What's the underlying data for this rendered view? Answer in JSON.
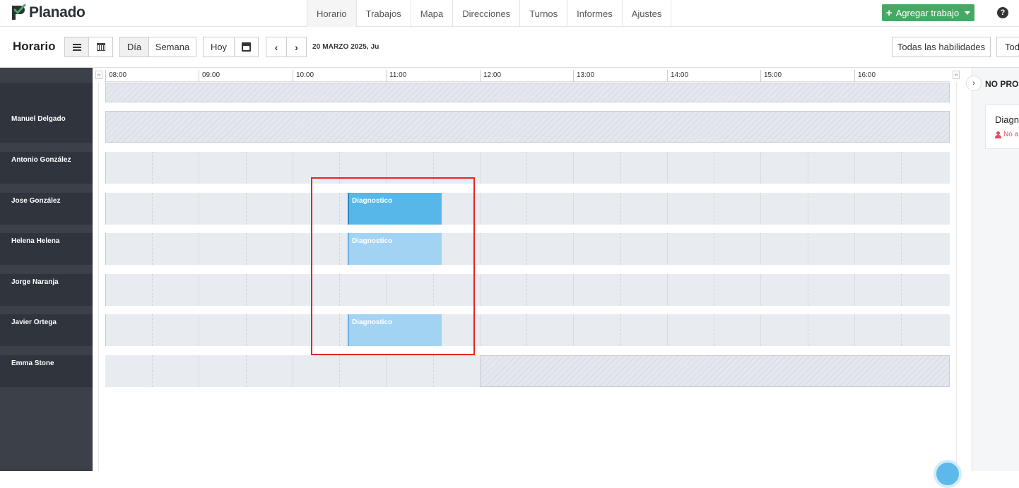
{
  "brand": {
    "name": "Planado",
    "accent": "#48a863"
  },
  "nav": {
    "tabs": [
      {
        "label": "Horario",
        "active": true
      },
      {
        "label": "Trabajos"
      },
      {
        "label": "Mapa"
      },
      {
        "label": "Direcciones"
      },
      {
        "label": "Turnos"
      },
      {
        "label": "Informes"
      },
      {
        "label": "Ajustes"
      }
    ],
    "add_button": "Agregar trabajo",
    "help_icon": "question-circle-icon"
  },
  "toolbar": {
    "title": "Horario",
    "view_day": "Día",
    "view_week": "Semana",
    "today": "Hoy",
    "date": "20 MARZO 2025, Ju",
    "skills_filter": "Todas las habilidades",
    "second_filter": "Tod"
  },
  "timeline": {
    "hours": [
      "08:00",
      "09:00",
      "10:00",
      "11:00",
      "12:00",
      "13:00",
      "14:00",
      "15:00",
      "16:00"
    ]
  },
  "resources": [
    {
      "name": ""
    },
    {
      "name": "Manuel Delgado"
    },
    {
      "name": "Antonio González"
    },
    {
      "name": "Jose González"
    },
    {
      "name": "Helena Helena"
    },
    {
      "name": "Jorge Naranja"
    },
    {
      "name": "Javier Ortega"
    },
    {
      "name": "Emma Stone"
    }
  ],
  "events": [
    {
      "resource": "Jose González",
      "title": "Diagnostico",
      "start": "10:35",
      "end": "11:35",
      "style": "strong"
    },
    {
      "resource": "Helena Helena",
      "title": "Diagnostico",
      "start": "10:35",
      "end": "11:35",
      "style": "light"
    },
    {
      "resource": "Javier Ortega",
      "title": "Diagnostico",
      "start": "10:35",
      "end": "11:35",
      "style": "light"
    }
  ],
  "unscheduled": {
    "title": "NO PRO",
    "card_title": "Diagno",
    "card_sub": "No a"
  },
  "colors": {
    "sidebar": "#3b4049",
    "event_strong": "#57b7e8",
    "event_light": "#a3d3f2",
    "highlight": "#e62424"
  }
}
